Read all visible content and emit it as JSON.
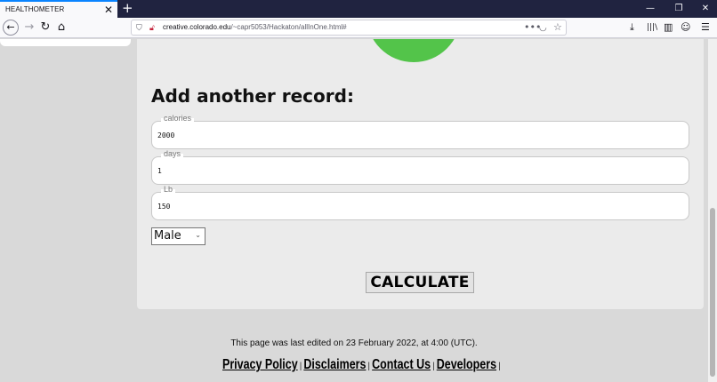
{
  "browser": {
    "tab_title": "HEALTHOMETER",
    "tab_close": "✕",
    "new_tab": "+",
    "url_host": "creative.colorado.edu",
    "url_path": "/~capr5053/Hackaton/allInOne.html#",
    "window_controls": [
      "—",
      "❐",
      "✕"
    ]
  },
  "form": {
    "title": "Add another record:",
    "fields": [
      {
        "legend": "calories",
        "value": "2000"
      },
      {
        "legend": "days",
        "value": "1"
      },
      {
        "legend": "Lb",
        "value": "150"
      }
    ],
    "gender_selected": "Male",
    "calculate_label": "CALCULATE"
  },
  "footer": {
    "last_edited": "This page was last edited on 23 February 2022, at 4:00 (UTC).",
    "links": [
      "Privacy Policy",
      "Disclaimers",
      "Contact Us",
      "Developers"
    ],
    "separator": "|"
  },
  "colors": {
    "accent_tab": "#0a84ff",
    "circle": "#53c44a",
    "tabbar": "#202340"
  },
  "icons": [
    "back-arrow-icon",
    "forward-arrow-icon",
    "reload-icon",
    "home-icon",
    "shield-icon",
    "insecure-lock-icon",
    "more-icon",
    "pocket-icon",
    "bookmark-star-icon",
    "download-icon",
    "library-icon",
    "sidebar-icon",
    "account-icon",
    "menu-icon"
  ]
}
